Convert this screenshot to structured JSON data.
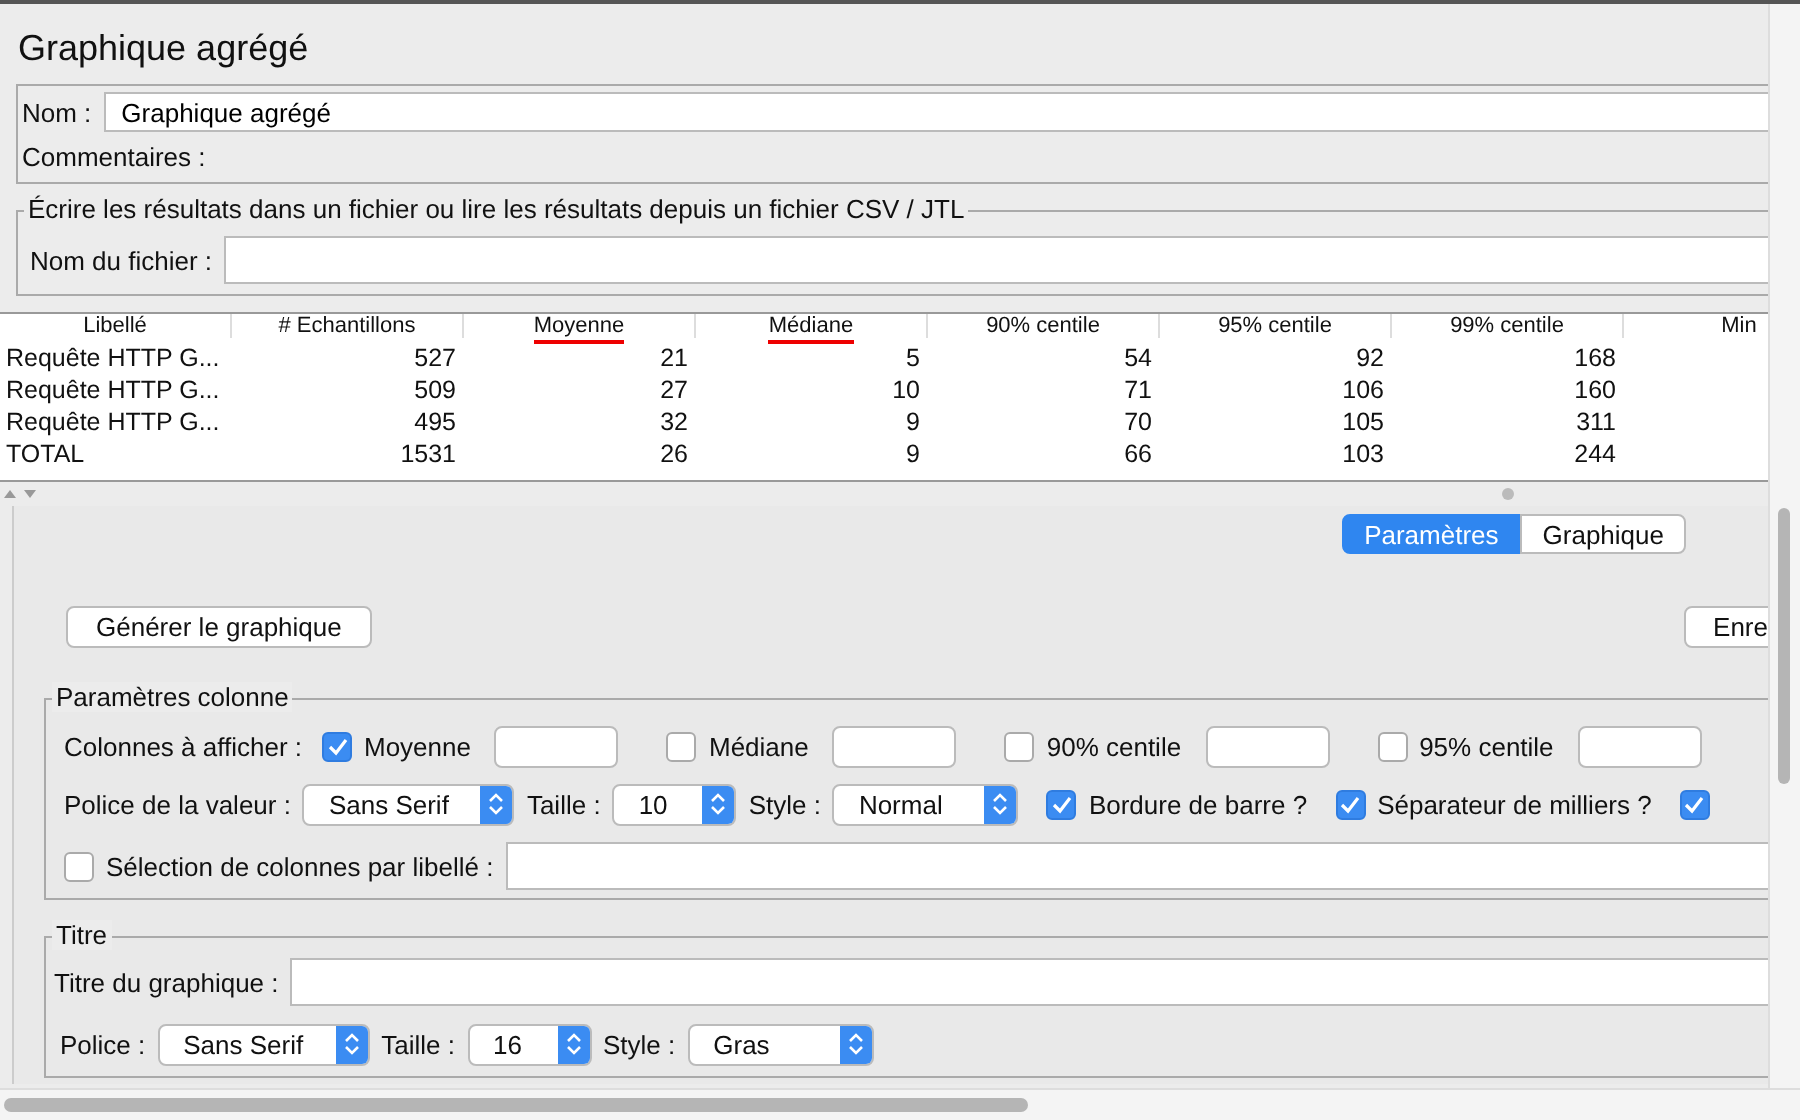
{
  "title": "Graphique agrégé",
  "name_field": {
    "label": "Nom :",
    "value": "Graphique agrégé"
  },
  "comments": {
    "label": "Commentaires :"
  },
  "file_group": {
    "title": "Écrire les résultats dans un fichier ou lire les résultats depuis un fichier CSV / JTL",
    "field_label": "Nom du fichier :"
  },
  "table": {
    "columns": [
      {
        "label": "Libellé",
        "underlined": false
      },
      {
        "label": "# Echantillons",
        "underlined": false
      },
      {
        "label": "Moyenne",
        "underlined": true
      },
      {
        "label": "Médiane",
        "underlined": true
      },
      {
        "label": "90% centile",
        "underlined": false
      },
      {
        "label": "95% centile",
        "underlined": false
      },
      {
        "label": "99% centile",
        "underlined": false
      },
      {
        "label": "Min",
        "underlined": false
      }
    ],
    "rows": [
      [
        "Requête HTTP G...",
        "527",
        "21",
        "5",
        "54",
        "92",
        "168"
      ],
      [
        "Requête HTTP G...",
        "509",
        "27",
        "10",
        "71",
        "106",
        "160"
      ],
      [
        "Requête HTTP G...",
        "495",
        "32",
        "9",
        "70",
        "105",
        "311"
      ],
      [
        "TOTAL",
        "1531",
        "26",
        "9",
        "66",
        "103",
        "244"
      ]
    ]
  },
  "tabs": [
    {
      "label": "Paramètres",
      "selected": true
    },
    {
      "label": "Graphique",
      "selected": false
    }
  ],
  "buttons": [
    "Générer le graphique",
    "Enre"
  ],
  "column_settings": {
    "title": "Paramètres colonne",
    "columns_label": "Colonnes à afficher :",
    "columns": [
      {
        "label": "Moyenne",
        "checked": true
      },
      {
        "label": "Médiane",
        "checked": false
      },
      {
        "label": "90% centile",
        "checked": false
      },
      {
        "label": "95% centile",
        "checked": false
      }
    ],
    "value_font": {
      "label": "Police de la valeur :",
      "value": "Sans Serif"
    },
    "size": {
      "label": "Taille :",
      "value": "10"
    },
    "style": {
      "label": "Style :",
      "value": "Normal"
    },
    "options": [
      {
        "label": "Bordure de barre ?",
        "checked": true
      },
      {
        "label": "Séparateur de milliers ?",
        "checked": true
      },
      {
        "checked": true
      }
    ],
    "label_filter": {
      "label": "Sélection de colonnes par libellé :",
      "checked": false
    }
  },
  "title_settings": {
    "title": "Titre",
    "chart_title_label": "Titre du graphique :",
    "font": {
      "label": "Police :",
      "value": "Sans Serif"
    },
    "size": {
      "label": "Taille :",
      "value": "16"
    },
    "style": {
      "label": "Style :",
      "value": "Gras"
    }
  }
}
